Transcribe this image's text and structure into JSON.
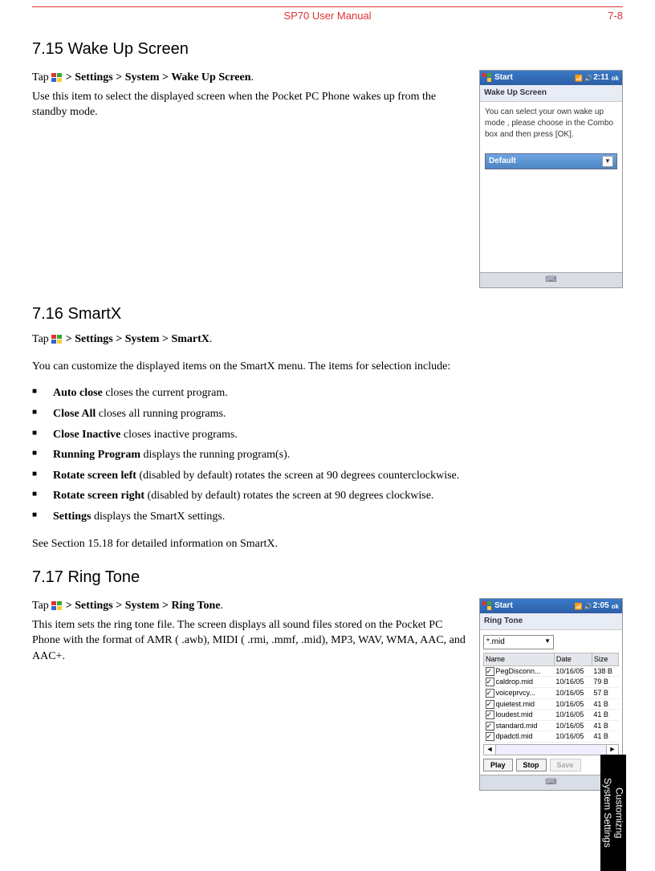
{
  "header": {
    "title": "SP70 User Manual",
    "page": "7-8"
  },
  "s715": {
    "heading": "7.15    Wake Up Screen",
    "tap_pre": "Tap ",
    "tap_path": " > Settings > System > Wake Up Screen",
    "period": ".",
    "desc": "Use this item to select the displayed screen when the Pocket PC Phone wakes up from the standby mode.",
    "dev": {
      "start": "Start",
      "time": "2:11",
      "ok": "ok",
      "sub": "Wake Up Screen",
      "body": "You can select your own wake up mode , please choose in the Combo box and then press [OK].",
      "combo": "Default"
    }
  },
  "s716": {
    "heading": "7.16    SmartX",
    "tap_pre": "Tap ",
    "tap_path": " > Settings > System > SmartX",
    "period": ".",
    "intro": "You can customize the displayed items on the SmartX menu. The items for selection include:",
    "items": [
      {
        "b": "Auto close",
        "t": "  closes the current program."
      },
      {
        "b": "Close All",
        "t": "  closes all running programs."
      },
      {
        "b": "Close Inactive",
        "t": "  closes inactive programs."
      },
      {
        "b": "Running Program",
        "t": "  displays the running program(s)."
      },
      {
        "b": "Rotate screen left",
        "t": "  (disabled by default) rotates the screen at 90 degrees counterclockwise."
      },
      {
        "b": "Rotate screen right",
        "t": "  (disabled by default) rotates the screen at 90 degrees clockwise."
      },
      {
        "b": "Settings",
        "t": "  displays the SmartX settings."
      }
    ],
    "post": "See Section 15.18 for detailed information on SmartX."
  },
  "s717": {
    "heading": "7.17    Ring Tone",
    "tap_pre": "Tap ",
    "tap_path": " > Settings > System > Ring Tone",
    "period": ".",
    "desc": "This item sets the ring tone file. The screen displays all sound files stored on the Pocket PC Phone with the format of AMR ( .awb), MIDI ( .rmi, .mmf, .mid), MP3, WAV, WMA, AAC, and AAC+.",
    "dev": {
      "start": "Start",
      "time": "2:05",
      "ok": "ok",
      "sub": "Ring Tone",
      "filter": "*.mid",
      "cols": {
        "c1": "Name",
        "c2": "Date",
        "c3": "Size"
      },
      "rows": [
        {
          "n": "PegDisconn...",
          "d": "10/16/05",
          "s": "138 B"
        },
        {
          "n": "caldrop.mid",
          "d": "10/16/05",
          "s": "79 B"
        },
        {
          "n": "voiceprvcy...",
          "d": "10/16/05",
          "s": "57 B"
        },
        {
          "n": "quietest.mid",
          "d": "10/16/05",
          "s": "41 B"
        },
        {
          "n": "loudest.mid",
          "d": "10/16/05",
          "s": "41 B"
        },
        {
          "n": "standard.mid",
          "d": "10/16/05",
          "s": "41 B"
        },
        {
          "n": "dpadctl.mid",
          "d": "10/16/05",
          "s": "41 B"
        }
      ],
      "play": "Play",
      "stop": "Stop",
      "save": "Save"
    }
  },
  "sidetab": {
    "l1": "Customizng",
    "l2": "System Settings"
  }
}
